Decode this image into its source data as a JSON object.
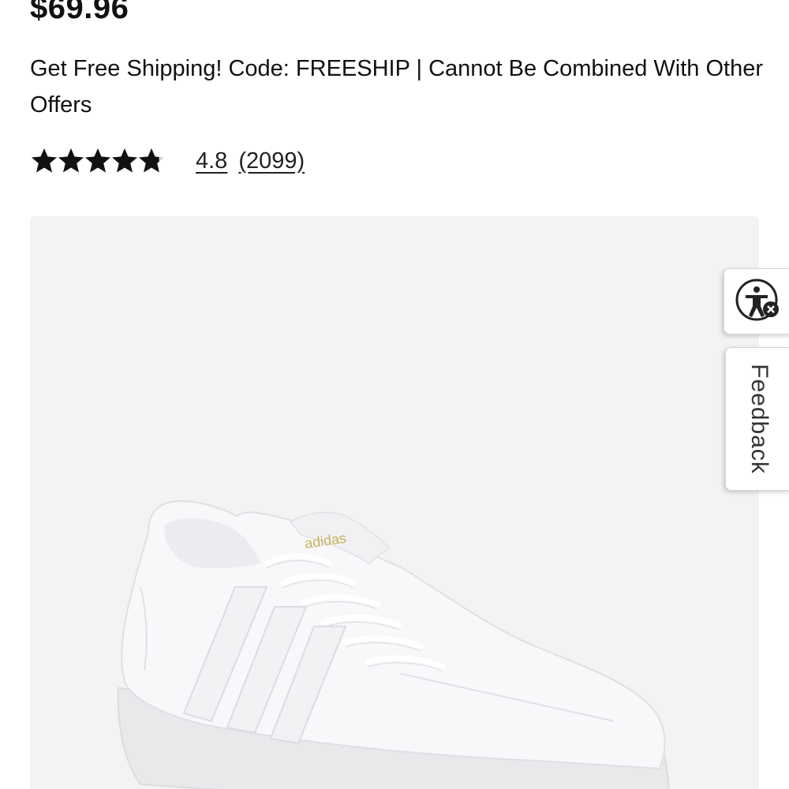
{
  "product": {
    "price": "$69.96",
    "promo_text": "Get Free Shipping! Code: FREESHIP | Cannot Be Combined With Other Offers",
    "rating": {
      "stars_out_of_5": 4.8,
      "value_label": "4.8",
      "count_label": "(2099)"
    },
    "image": {
      "subject": "white low-top leather sneaker with three stripes",
      "background_color": "#f3f3f3"
    }
  },
  "side_tabs": {
    "accessibility_icon": "accessibility-icon",
    "feedback_label": "Feedback"
  },
  "colors": {
    "text": "#111111",
    "star": "#111111",
    "panel": "#f3f3f3"
  }
}
